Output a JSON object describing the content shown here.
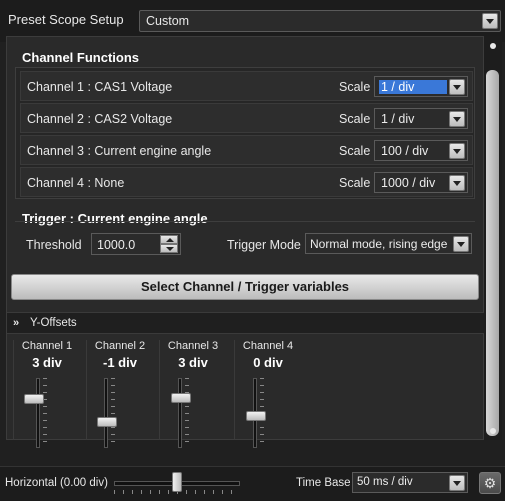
{
  "preset": {
    "label": "Preset Scope Setup",
    "value": "Custom"
  },
  "channel_functions": {
    "title": "Channel Functions",
    "scale_label": "Scale",
    "rows": [
      {
        "name": "Channel 1 : CAS1 Voltage",
        "scale": "1 / div"
      },
      {
        "name": "Channel 2 : CAS2 Voltage",
        "scale": "1 / div"
      },
      {
        "name": "Channel 3 : Current engine angle",
        "scale": "100 / div"
      },
      {
        "name": "Channel 4 : None",
        "scale": "1000 / div"
      }
    ]
  },
  "trigger": {
    "title": "Trigger : Current engine angle",
    "threshold_label": "Threshold",
    "threshold_value": "1000.0",
    "mode_label": "Trigger Mode",
    "mode_value": "Normal mode, rising edge"
  },
  "select_button": "Select Channel / Trigger variables",
  "y_offsets": {
    "title": "Y-Offsets",
    "channels": [
      {
        "name": "Channel 1",
        "value": "3 div"
      },
      {
        "name": "Channel 2",
        "value": "-1 div"
      },
      {
        "name": "Channel 3",
        "value": "3 div"
      },
      {
        "name": "Channel 4",
        "value": "0 div"
      }
    ]
  },
  "bottom": {
    "horizontal_label": "Horizontal (0.00 div)",
    "timebase_label": "Time Base",
    "timebase_value": "50 ms / div"
  },
  "icons": [
    "chevron-down-icon",
    "gear-icon",
    "spin-up-icon",
    "spin-down-icon"
  ]
}
